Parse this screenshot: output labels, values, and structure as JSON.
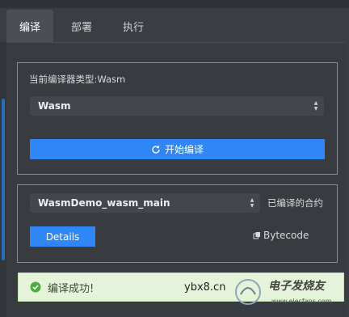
{
  "tabs": [
    {
      "label": "编译",
      "active": true
    },
    {
      "label": "部署",
      "active": false
    },
    {
      "label": "执行",
      "active": false
    }
  ],
  "compiler": {
    "type_label": "当前编译器类型:Wasm",
    "selected": "Wasm",
    "compile_button": "开始编译"
  },
  "contract": {
    "selected": "WasmDemo_wasm_main",
    "compiled_label": "已编译的合约",
    "details_button": "Details",
    "bytecode_link": "Bytecode"
  },
  "status": {
    "message": "编译成功!",
    "color": "#e4f3d9",
    "icon": "check-circle-icon"
  },
  "watermark": {
    "site": "ybx8.cn",
    "brand": "电子发烧友",
    "url": "www.elecfans.com"
  },
  "colors": {
    "accent": "#2f86f6",
    "success_icon": "#4caf3a"
  }
}
